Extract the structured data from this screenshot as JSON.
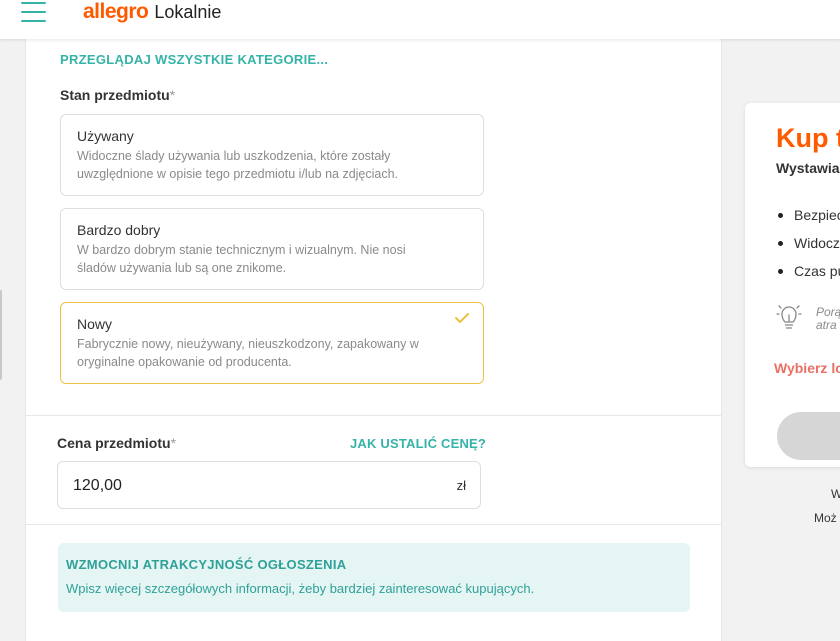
{
  "header": {
    "logo_brand": "allegro",
    "logo_sub": "Lokalnie"
  },
  "category": {
    "browse_all": "PRZEGLĄDAJ WSZYSTKIE KATEGORIE..."
  },
  "condition": {
    "label": "Stan przedmiotu",
    "required_mark": "*",
    "options": [
      {
        "title": "Używany",
        "line1": "Widoczne ślady używania lub uszkodzenia, które zostały",
        "line2": "uwzględnione w opisie tego przedmiotu i/lub na zdjęciach."
      },
      {
        "title": "Bardzo dobry",
        "line1": "W bardzo dobrym stanie technicznym i wizualnym. Nie nosi",
        "line2": "śladów używania lub są one znikome."
      },
      {
        "title": "Nowy",
        "line1": "Fabrycznie nowy, nieużywany, nieuszkodzony, zapakowany w",
        "line2": "oryginalne opakowanie od producenta."
      }
    ],
    "selected": "Nowy"
  },
  "price": {
    "label": "Cena przedmiotu",
    "required_mark": "*",
    "help_link": "JAK USTALIĆ CENĘ?",
    "value": "120,00",
    "unit": "zł"
  },
  "tip": {
    "title": "WZMOCNIJ ATRAKCYJNOŚĆ OGŁOSZENIA",
    "description": "Wpisz więcej szczegółowych informacji, żeby bardziej zainteresować kupujących."
  },
  "sidebar": {
    "title": "Kup t",
    "subtitle": "Wystawia",
    "bullets": [
      "Bezpiec",
      "Widocz",
      "Czas pu"
    ],
    "hint_line1": "Porą",
    "hint_line2": "atra",
    "choose": "Wybierz lo",
    "foot1": "W",
    "foot2": "Moż"
  },
  "colors": {
    "accent_teal": "#36b3a8",
    "brand_orange": "#ff5a00",
    "selected_border": "#ecc141",
    "warning_red": "#ea7066",
    "tip_background": "#e5f5f3"
  }
}
